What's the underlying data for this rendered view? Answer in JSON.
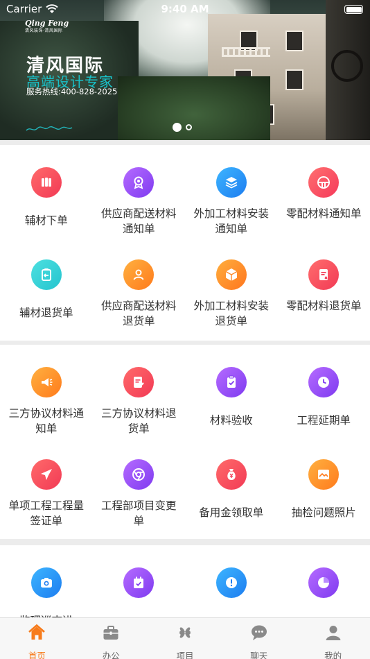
{
  "status_bar": {
    "carrier": "Carrier",
    "time": "9:40 AM"
  },
  "banner": {
    "logo_text": "Qing Feng",
    "logo_sub": "清风装饰·清风国际",
    "title": "清风国际",
    "slogan": "高端设计专家",
    "hotline": "服务热线:400-828-2025",
    "signature": "&#x1F58B;",
    "page_indicator": {
      "current": 1,
      "total": 2
    }
  },
  "sections": [
    {
      "items": [
        {
          "label": "辅材下单",
          "icon": "pillars-icon",
          "color_from": "#ff6a6a",
          "color_to": "#f23a55"
        },
        {
          "label": "供应商配送材料通知单",
          "icon": "badge-icon",
          "color_from": "#b56bff",
          "color_to": "#7f3bf0"
        },
        {
          "label": "外加工材料安装通知单",
          "icon": "layers-icon",
          "color_from": "#3db5ff",
          "color_to": "#1d7df0"
        },
        {
          "label": "零配材料通知单",
          "icon": "tray-icon",
          "color_from": "#ff7070",
          "color_to": "#f5395a"
        },
        {
          "label": "辅材退货单",
          "icon": "return-clipboard-icon",
          "color_from": "#4de0e0",
          "color_to": "#25c4cf"
        },
        {
          "label": "供应商配送材料退货单",
          "icon": "person-icon",
          "color_from": "#ffb040",
          "color_to": "#ff7b1c"
        },
        {
          "label": "外加工材料安装退货单",
          "icon": "box-icon",
          "color_from": "#ffae3d",
          "color_to": "#ff761e"
        },
        {
          "label": "零配材料退货单",
          "icon": "document-cancel-icon",
          "color_from": "#ff6d6d",
          "color_to": "#f23a55"
        }
      ]
    },
    {
      "items": [
        {
          "label": "三方协议材料通知单",
          "icon": "megaphone-icon",
          "color_from": "#ffb040",
          "color_to": "#ff7b1c"
        },
        {
          "label": "三方协议材料退货单",
          "icon": "document-edit-icon",
          "color_from": "#ff6a6a",
          "color_to": "#f23a55"
        },
        {
          "label": "材料验收",
          "icon": "clipboard-check-icon",
          "color_from": "#b56bff",
          "color_to": "#7f3bf0"
        },
        {
          "label": "工程延期单",
          "icon": "clock-icon",
          "color_from": "#b56bff",
          "color_to": "#7f3bf0"
        },
        {
          "label": "单项工程工程量签证单",
          "icon": "airplane-icon",
          "color_from": "#ff6a6a",
          "color_to": "#f23a55"
        },
        {
          "label": "工程部项目变更单",
          "icon": "chrome-icon",
          "color_from": "#b56bff",
          "color_to": "#7f3bf0"
        },
        {
          "label": "备用金领取单",
          "icon": "money-bag-icon",
          "color_from": "#ff6a6a",
          "color_to": "#f23a55"
        },
        {
          "label": "抽检问题照片",
          "icon": "picture-icon",
          "color_from": "#ffb040",
          "color_to": "#ff7b1c"
        }
      ]
    },
    {
      "items": [
        {
          "label": "监理巡查进",
          "icon": "camera-icon",
          "color_from": "#3db5ff",
          "color_to": "#1d7df0"
        },
        {
          "label": "",
          "icon": "calendar-check-icon",
          "color_from": "#b56bff",
          "color_to": "#7f3bf0"
        },
        {
          "label": "",
          "icon": "alert-icon",
          "color_from": "#3db5ff",
          "color_to": "#1d7df0"
        },
        {
          "label": "",
          "icon": "pie-icon",
          "color_from": "#b56bff",
          "color_to": "#7f3bf0"
        }
      ]
    }
  ],
  "tab_bar": {
    "active_color": "#f77b1b",
    "tabs": [
      {
        "label": "首页",
        "icon": "home-icon"
      },
      {
        "label": "办公",
        "icon": "briefcase-icon"
      },
      {
        "label": "项目",
        "icon": "grid-icon"
      },
      {
        "label": "聊天",
        "icon": "chat-icon"
      },
      {
        "label": "我的",
        "icon": "user-icon"
      }
    ]
  }
}
